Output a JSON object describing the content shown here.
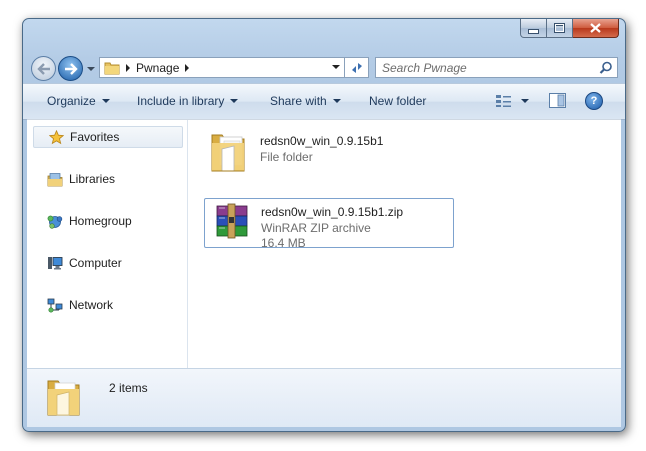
{
  "address": {
    "path_segment": "Pwnage"
  },
  "search": {
    "placeholder": "Search Pwnage"
  },
  "commandbar": {
    "organize": "Organize",
    "include_in_library": "Include in library",
    "share_with": "Share with",
    "new_folder": "New folder",
    "help": "?"
  },
  "nav": {
    "items": [
      {
        "label": "Favorites",
        "icon": "star-icon"
      },
      {
        "label": "Libraries",
        "icon": "libraries-icon"
      },
      {
        "label": "Homegroup",
        "icon": "homegroup-icon"
      },
      {
        "label": "Computer",
        "icon": "computer-icon"
      },
      {
        "label": "Network",
        "icon": "network-icon"
      }
    ]
  },
  "files": [
    {
      "name": "redsn0w_win_0.9.15b1",
      "type": "File folder",
      "icon": "folder-icon"
    },
    {
      "name": "redsn0w_win_0.9.15b1.zip",
      "type": "WinRAR ZIP archive",
      "size": "16.4 MB",
      "icon": "winrar-archive-icon"
    }
  ],
  "details": {
    "item_count": "2 items"
  },
  "colors": {
    "window_frame": "#b4cce6",
    "accent": "#1d5ea8",
    "close_button": "#c94a2c",
    "selection_border": "#7da2ce"
  }
}
